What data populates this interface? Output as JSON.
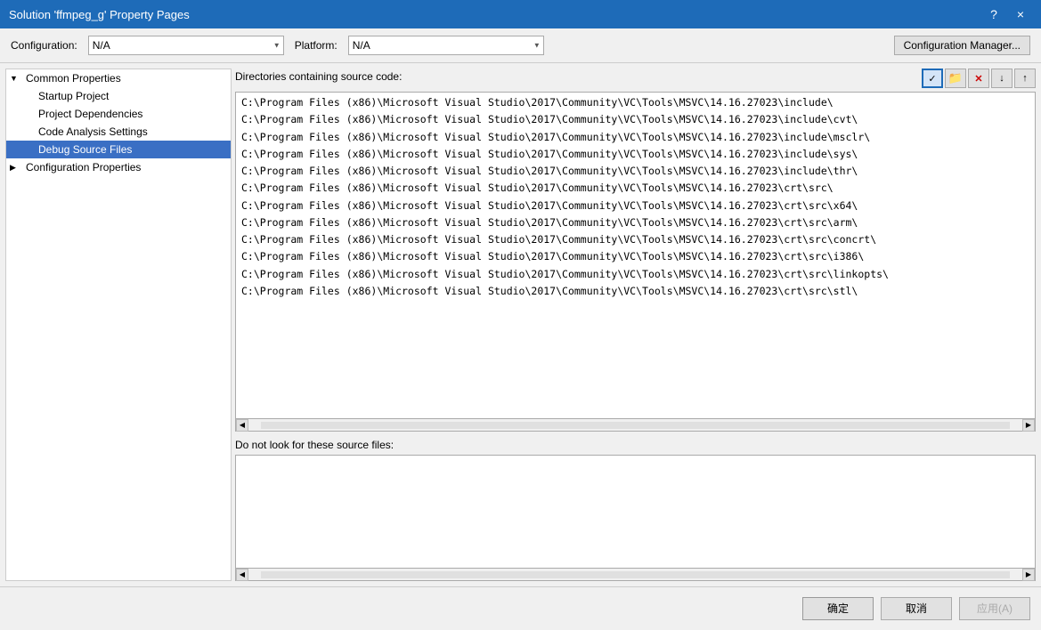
{
  "titlebar": {
    "title": "Solution 'ffmpeg_g' Property Pages",
    "help_label": "?",
    "close_label": "×"
  },
  "config_bar": {
    "configuration_label": "Configuration:",
    "configuration_value": "N/A",
    "platform_label": "Platform:",
    "platform_value": "N/A",
    "config_manager_label": "Configuration Manager..."
  },
  "sidebar": {
    "items": [
      {
        "id": "common-properties",
        "label": "Common Properties",
        "level": 0,
        "expander": "▼",
        "selected": false
      },
      {
        "id": "startup-project",
        "label": "Startup Project",
        "level": 1,
        "expander": "",
        "selected": false
      },
      {
        "id": "project-dependencies",
        "label": "Project Dependencies",
        "level": 1,
        "expander": "",
        "selected": false
      },
      {
        "id": "code-analysis-settings",
        "label": "Code Analysis Settings",
        "level": 1,
        "expander": "",
        "selected": false
      },
      {
        "id": "debug-source-files",
        "label": "Debug Source Files",
        "level": 1,
        "expander": "",
        "selected": true
      },
      {
        "id": "configuration-properties",
        "label": "Configuration Properties",
        "level": 0,
        "expander": "▶",
        "selected": false
      }
    ]
  },
  "main": {
    "directories_label": "Directories containing source code:",
    "directories": [
      "C:\\Program Files (x86)\\Microsoft Visual Studio\\2017\\Community\\VC\\Tools\\MSVC\\14.16.27023\\include\\",
      "C:\\Program Files (x86)\\Microsoft Visual Studio\\2017\\Community\\VC\\Tools\\MSVC\\14.16.27023\\include\\cvt\\",
      "C:\\Program Files (x86)\\Microsoft Visual Studio\\2017\\Community\\VC\\Tools\\MSVC\\14.16.27023\\include\\msclr\\",
      "C:\\Program Files (x86)\\Microsoft Visual Studio\\2017\\Community\\VC\\Tools\\MSVC\\14.16.27023\\include\\sys\\",
      "C:\\Program Files (x86)\\Microsoft Visual Studio\\2017\\Community\\VC\\Tools\\MSVC\\14.16.27023\\include\\thr\\",
      "C:\\Program Files (x86)\\Microsoft Visual Studio\\2017\\Community\\VC\\Tools\\MSVC\\14.16.27023\\crt\\src\\",
      "C:\\Program Files (x86)\\Microsoft Visual Studio\\2017\\Community\\VC\\Tools\\MSVC\\14.16.27023\\crt\\src\\x64\\",
      "C:\\Program Files (x86)\\Microsoft Visual Studio\\2017\\Community\\VC\\Tools\\MSVC\\14.16.27023\\crt\\src\\arm\\",
      "C:\\Program Files (x86)\\Microsoft Visual Studio\\2017\\Community\\VC\\Tools\\MSVC\\14.16.27023\\crt\\src\\concrt\\",
      "C:\\Program Files (x86)\\Microsoft Visual Studio\\2017\\Community\\VC\\Tools\\MSVC\\14.16.27023\\crt\\src\\i386\\",
      "C:\\Program Files (x86)\\Microsoft Visual Studio\\2017\\Community\\VC\\Tools\\MSVC\\14.16.27023\\crt\\src\\linkopts\\",
      "C:\\Program Files (x86)\\Microsoft Visual Studio\\2017\\Community\\VC\\Tools\\MSVC\\14.16.27023\\crt\\src\\stl\\"
    ],
    "donot_label": "Do not look for these source files:",
    "donot_items": [],
    "toolbar": {
      "checkmark_label": "✓",
      "folder_label": "📁",
      "delete_label": "✕",
      "down_label": "↓",
      "up_label": "↑"
    }
  },
  "bottom_bar": {
    "confirm_label": "确定",
    "cancel_label": "取消",
    "apply_label": "应用(A)"
  }
}
